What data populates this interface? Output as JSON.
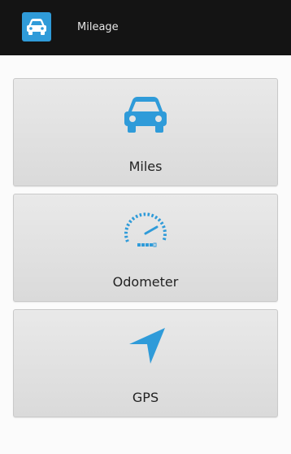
{
  "app_bar": {
    "title": "Mileage",
    "icon": "car-icon"
  },
  "colors": {
    "accent": "#2f9bd9",
    "app_bar_bg": "#141414"
  },
  "options": [
    {
      "label": "Miles",
      "icon": "car-icon"
    },
    {
      "label": "Odometer",
      "icon": "speedometer-icon"
    },
    {
      "label": "GPS",
      "icon": "navigation-arrow-icon"
    }
  ]
}
